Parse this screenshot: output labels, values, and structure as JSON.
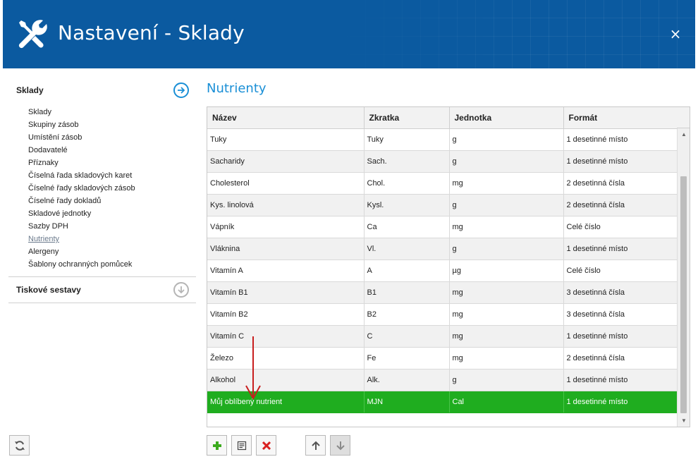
{
  "window": {
    "title": "Nastavení - Sklady",
    "close_label": "×",
    "header_color": "#0b5aa0"
  },
  "sidebar": {
    "sections": [
      {
        "title": "Sklady",
        "icon": "arrow-right-circle-icon",
        "items": [
          {
            "label": "Sklady"
          },
          {
            "label": "Skupiny zásob"
          },
          {
            "label": "Umístění zásob"
          },
          {
            "label": "Dodavatelé"
          },
          {
            "label": "Příznaky"
          },
          {
            "label": "Číselná řada skladových karet"
          },
          {
            "label": "Číselné řady skladových zásob"
          },
          {
            "label": "Číselné řady dokladů"
          },
          {
            "label": "Skladové jednotky"
          },
          {
            "label": "Sazby DPH"
          },
          {
            "label": "Nutrienty",
            "active": true
          },
          {
            "label": "Alergeny"
          },
          {
            "label": "Šablony ochranných pomůcek"
          }
        ]
      },
      {
        "title": "Tiskové sestavy",
        "icon": "arrow-down-circle-icon"
      }
    ],
    "refresh_icon": "refresh-icon"
  },
  "main": {
    "title": "Nutrienty",
    "accent_color": "#1a8fd6",
    "selected_row_color": "#1fad1f",
    "columns": [
      "Název",
      "Zkratka",
      "Jednotka",
      "Formát"
    ],
    "rows": [
      [
        "Tuky",
        "Tuky",
        "g",
        "1 desetinné místo"
      ],
      [
        "Sacharidy",
        "Sach.",
        "g",
        "1 desetinné místo"
      ],
      [
        "Cholesterol",
        "Chol.",
        "mg",
        "2 desetinná čísla"
      ],
      [
        "Kys. linolová",
        "Kysl.",
        "g",
        "2 desetinná čísla"
      ],
      [
        "Vápník",
        "Ca",
        "mg",
        "Celé číslo"
      ],
      [
        "Vláknina",
        "Vl.",
        "g",
        "1 desetinné místo"
      ],
      [
        "Vitamín A",
        "A",
        "µg",
        "Celé číslo"
      ],
      [
        "Vitamín B1",
        "B1",
        "mg",
        "3 desetinná čísla"
      ],
      [
        "Vitamín B2",
        "B2",
        "mg",
        "3 desetinná čísla"
      ],
      [
        "Vitamín C",
        "C",
        "mg",
        "1 desetinné místo"
      ],
      [
        "Železo",
        "Fe",
        "mg",
        "2 desetinná čísla"
      ],
      [
        "Alkohol",
        "Alk.",
        "g",
        "1 desetinné místo"
      ],
      [
        "Můj oblíbený nutrient",
        "MJN",
        "Cal",
        "1 desetinné místo"
      ]
    ],
    "selected_row_index": 12,
    "toolbar": [
      {
        "icon": "add-icon"
      },
      {
        "icon": "edit-icon"
      },
      {
        "icon": "delete-icon"
      },
      {
        "icon": "move-up-icon"
      },
      {
        "icon": "move-down-icon",
        "disabled": true
      }
    ]
  }
}
